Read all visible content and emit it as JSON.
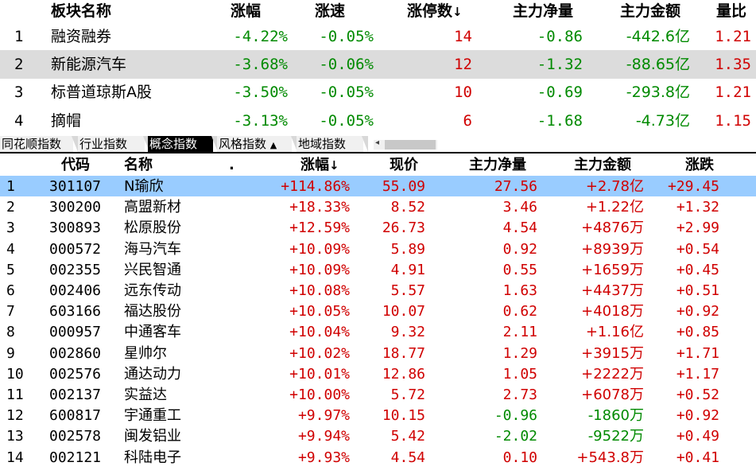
{
  "sector_table": {
    "headers": [
      "板块名称",
      "涨幅",
      "涨速",
      "涨停数",
      "主力净量",
      "主力金额",
      "量比"
    ],
    "sort_column_arrow": "↓",
    "rows": [
      {
        "idx": "1",
        "name": "融资融券",
        "change_pct": "-4.22%",
        "speed": "-0.05%",
        "limit_up": "14",
        "net_vol": "-0.86",
        "net_amount": "-442.6亿",
        "vol_ratio": "1.21"
      },
      {
        "idx": "2",
        "name": "新能源汽车",
        "change_pct": "-3.68%",
        "speed": "-0.06%",
        "limit_up": "12",
        "net_vol": "-1.32",
        "net_amount": "-88.65亿",
        "vol_ratio": "1.35"
      },
      {
        "idx": "3",
        "name": "标普道琼斯A股",
        "change_pct": "-3.50%",
        "speed": "-0.05%",
        "limit_up": "10",
        "net_vol": "-0.69",
        "net_amount": "-293.8亿",
        "vol_ratio": "1.21"
      },
      {
        "idx": "4",
        "name": "摘帽",
        "change_pct": "-3.13%",
        "speed": "-0.05%",
        "limit_up": "6",
        "net_vol": "-1.68",
        "net_amount": "-4.73亿",
        "vol_ratio": "1.15"
      }
    ]
  },
  "tabs": [
    {
      "label": "同花顺指数",
      "active": false
    },
    {
      "label": "行业指数",
      "active": false
    },
    {
      "label": "概念指数",
      "active": true
    },
    {
      "label": "风格指数",
      "active": false,
      "dropdown": "▲"
    },
    {
      "label": "地域指数",
      "active": false
    }
  ],
  "stock_table": {
    "headers": [
      "代码",
      "名称",
      ".",
      "涨幅",
      "现价",
      "主力净量",
      "主力金额",
      "涨跌"
    ],
    "sort_column_arrow": "↓",
    "rows": [
      {
        "idx": "1",
        "code": "301107",
        "name": "N瑜欣",
        "change_pct": "+114.86%",
        "price": "55.09",
        "net_vol": "27.56",
        "net_amount": "+2.78亿",
        "change": "+29.45"
      },
      {
        "idx": "2",
        "code": "300200",
        "name": "高盟新材",
        "change_pct": "+18.33%",
        "price": "8.52",
        "net_vol": "3.46",
        "net_amount": "+1.22亿",
        "change": "+1.32"
      },
      {
        "idx": "3",
        "code": "300893",
        "name": "松原股份",
        "change_pct": "+12.59%",
        "price": "26.73",
        "net_vol": "4.54",
        "net_amount": "+4876万",
        "change": "+2.99"
      },
      {
        "idx": "4",
        "code": "000572",
        "name": "海马汽车",
        "change_pct": "+10.09%",
        "price": "5.89",
        "net_vol": "0.92",
        "net_amount": "+8939万",
        "change": "+0.54"
      },
      {
        "idx": "5",
        "code": "002355",
        "name": "兴民智通",
        "change_pct": "+10.09%",
        "price": "4.91",
        "net_vol": "0.55",
        "net_amount": "+1659万",
        "change": "+0.45"
      },
      {
        "idx": "6",
        "code": "002406",
        "name": "远东传动",
        "change_pct": "+10.08%",
        "price": "5.57",
        "net_vol": "1.63",
        "net_amount": "+4437万",
        "change": "+0.51"
      },
      {
        "idx": "7",
        "code": "603166",
        "name": "福达股份",
        "change_pct": "+10.05%",
        "price": "10.07",
        "net_vol": "0.62",
        "net_amount": "+4018万",
        "change": "+0.92"
      },
      {
        "idx": "8",
        "code": "000957",
        "name": "中通客车",
        "change_pct": "+10.04%",
        "price": "9.32",
        "net_vol": "2.11",
        "net_amount": "+1.16亿",
        "change": "+0.85"
      },
      {
        "idx": "9",
        "code": "002860",
        "name": "星帅尔",
        "change_pct": "+10.02%",
        "price": "18.77",
        "net_vol": "1.29",
        "net_amount": "+3915万",
        "change": "+1.71"
      },
      {
        "idx": "10",
        "code": "002576",
        "name": "通达动力",
        "change_pct": "+10.01%",
        "price": "12.86",
        "net_vol": "1.05",
        "net_amount": "+2222万",
        "change": "+1.17"
      },
      {
        "idx": "11",
        "code": "002137",
        "name": "实益达",
        "change_pct": "+10.00%",
        "price": "5.72",
        "net_vol": "2.73",
        "net_amount": "+6078万",
        "change": "+0.52"
      },
      {
        "idx": "12",
        "code": "600817",
        "name": "宇通重工",
        "change_pct": "+9.97%",
        "price": "10.15",
        "net_vol": "-0.96",
        "net_amount": "-1860万",
        "change": "+0.92"
      },
      {
        "idx": "13",
        "code": "002578",
        "name": "闽发铝业",
        "change_pct": "+9.94%",
        "price": "5.42",
        "net_vol": "-2.02",
        "net_amount": "-9522万",
        "change": "+0.49"
      },
      {
        "idx": "14",
        "code": "002121",
        "name": "科陆电子",
        "change_pct": "+9.93%",
        "price": "4.54",
        "net_vol": "0.10",
        "net_amount": "+543.8万",
        "change": "+0.41"
      }
    ]
  },
  "colors": {
    "up": "#d00000",
    "down": "#008a00",
    "selected_row": "#99ccff",
    "highlight_row": "#dcdcdc",
    "active_tab": "#000000"
  }
}
